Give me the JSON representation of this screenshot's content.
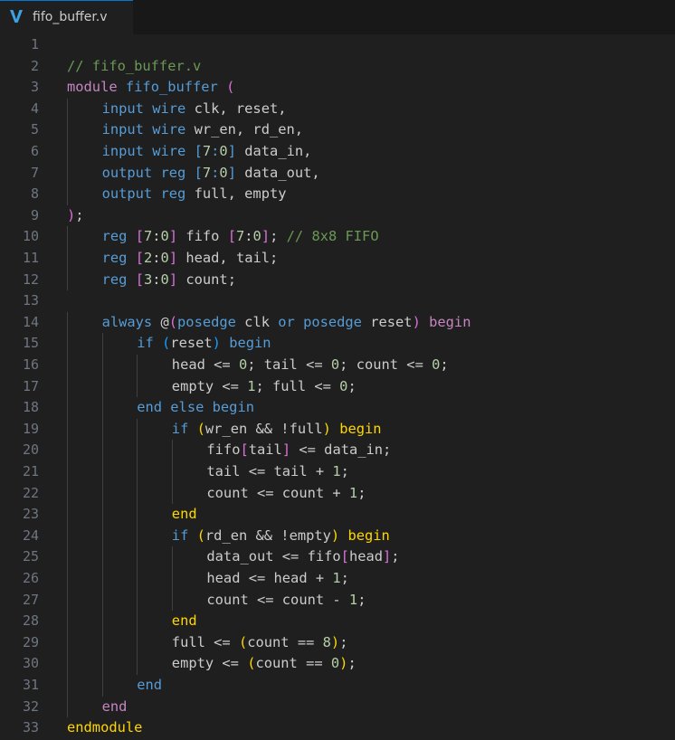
{
  "tab": {
    "icon": "verilog-file-icon",
    "label": "fifo_buffer.v",
    "accent": "#0078d4",
    "icon_color": "#3ca2e6"
  },
  "lines": [
    {
      "n": "1",
      "indent": 0,
      "tokens": []
    },
    {
      "n": "2",
      "indent": 0,
      "tokens": [
        {
          "t": "// fifo_buffer.v",
          "c": "cmt"
        }
      ]
    },
    {
      "n": "3",
      "indent": 0,
      "tokens": [
        {
          "t": "module",
          "c": "ctl"
        },
        {
          "t": " "
        },
        {
          "t": "fifo_buffer",
          "c": "kw"
        },
        {
          "t": " "
        },
        {
          "t": "(",
          "c": "paren-p"
        }
      ]
    },
    {
      "n": "4",
      "indent": 1,
      "tokens": [
        {
          "t": "input",
          "c": "kw"
        },
        {
          "t": " "
        },
        {
          "t": "wire",
          "c": "kw"
        },
        {
          "t": " clk, reset,"
        }
      ]
    },
    {
      "n": "5",
      "indent": 1,
      "tokens": [
        {
          "t": "input",
          "c": "kw"
        },
        {
          "t": " "
        },
        {
          "t": "wire",
          "c": "kw"
        },
        {
          "t": " wr_en, rd_en,"
        }
      ]
    },
    {
      "n": "6",
      "indent": 1,
      "tokens": [
        {
          "t": "input",
          "c": "kw"
        },
        {
          "t": " "
        },
        {
          "t": "wire",
          "c": "kw"
        },
        {
          "t": " "
        },
        {
          "t": "[",
          "c": "kw"
        },
        {
          "t": "7",
          "c": "num"
        },
        {
          "t": ":",
          "c": "kw"
        },
        {
          "t": "0",
          "c": "num"
        },
        {
          "t": "]",
          "c": "kw"
        },
        {
          "t": " data_in,"
        }
      ]
    },
    {
      "n": "7",
      "indent": 1,
      "tokens": [
        {
          "t": "output",
          "c": "kw"
        },
        {
          "t": " "
        },
        {
          "t": "reg",
          "c": "kw"
        },
        {
          "t": " "
        },
        {
          "t": "[",
          "c": "kw"
        },
        {
          "t": "7",
          "c": "num"
        },
        {
          "t": ":",
          "c": "kw"
        },
        {
          "t": "0",
          "c": "num"
        },
        {
          "t": "]",
          "c": "kw"
        },
        {
          "t": " data_out,"
        }
      ]
    },
    {
      "n": "8",
      "indent": 1,
      "tokens": [
        {
          "t": "output",
          "c": "kw"
        },
        {
          "t": " "
        },
        {
          "t": "reg",
          "c": "kw"
        },
        {
          "t": " full, empty"
        }
      ]
    },
    {
      "n": "9",
      "indent": 0,
      "tokens": [
        {
          "t": ")",
          "c": "paren-p"
        },
        {
          "t": ";"
        }
      ]
    },
    {
      "n": "10",
      "indent": 1,
      "tokens": [
        {
          "t": "reg",
          "c": "kw"
        },
        {
          "t": " "
        },
        {
          "t": "[",
          "c": "paren-p"
        },
        {
          "t": "7",
          "c": "num"
        },
        {
          "t": ":",
          "c": "id"
        },
        {
          "t": "0",
          "c": "num"
        },
        {
          "t": "]",
          "c": "paren-p"
        },
        {
          "t": " fifo "
        },
        {
          "t": "[",
          "c": "paren-p"
        },
        {
          "t": "7",
          "c": "num"
        },
        {
          "t": ":",
          "c": "id"
        },
        {
          "t": "0",
          "c": "num"
        },
        {
          "t": "]",
          "c": "paren-p"
        },
        {
          "t": "; "
        },
        {
          "t": "// 8x8 FIFO",
          "c": "cmt"
        }
      ]
    },
    {
      "n": "11",
      "indent": 1,
      "tokens": [
        {
          "t": "reg",
          "c": "kw"
        },
        {
          "t": " "
        },
        {
          "t": "[",
          "c": "paren-p"
        },
        {
          "t": "2",
          "c": "num"
        },
        {
          "t": ":",
          "c": "id"
        },
        {
          "t": "0",
          "c": "num"
        },
        {
          "t": "]",
          "c": "paren-p"
        },
        {
          "t": " head, tail;"
        }
      ]
    },
    {
      "n": "12",
      "indent": 1,
      "tokens": [
        {
          "t": "reg",
          "c": "kw"
        },
        {
          "t": " "
        },
        {
          "t": "[",
          "c": "paren-p"
        },
        {
          "t": "3",
          "c": "num"
        },
        {
          "t": ":",
          "c": "id"
        },
        {
          "t": "0",
          "c": "num"
        },
        {
          "t": "]",
          "c": "paren-p"
        },
        {
          "t": " count;"
        }
      ]
    },
    {
      "n": "13",
      "indent": 0,
      "tokens": []
    },
    {
      "n": "14",
      "indent": 1,
      "tokens": [
        {
          "t": "always",
          "c": "kw"
        },
        {
          "t": " @"
        },
        {
          "t": "(",
          "c": "paren-p"
        },
        {
          "t": "posedge",
          "c": "kw"
        },
        {
          "t": " clk "
        },
        {
          "t": "or",
          "c": "kw"
        },
        {
          "t": " "
        },
        {
          "t": "posedge",
          "c": "kw"
        },
        {
          "t": " reset"
        },
        {
          "t": ")",
          "c": "paren-p"
        },
        {
          "t": " "
        },
        {
          "t": "begin",
          "c": "ctl"
        }
      ]
    },
    {
      "n": "15",
      "indent": 2,
      "tokens": [
        {
          "t": "if",
          "c": "kw"
        },
        {
          "t": " "
        },
        {
          "t": "(",
          "c": "paren-b"
        },
        {
          "t": "reset"
        },
        {
          "t": ")",
          "c": "paren-b"
        },
        {
          "t": " "
        },
        {
          "t": "begin",
          "c": "kw"
        }
      ]
    },
    {
      "n": "16",
      "indent": 3,
      "tokens": [
        {
          "t": "head <= "
        },
        {
          "t": "0",
          "c": "num"
        },
        {
          "t": "; tail <= "
        },
        {
          "t": "0",
          "c": "num"
        },
        {
          "t": "; count <= "
        },
        {
          "t": "0",
          "c": "num"
        },
        {
          "t": ";"
        }
      ]
    },
    {
      "n": "17",
      "indent": 3,
      "tokens": [
        {
          "t": "empty <= "
        },
        {
          "t": "1",
          "c": "num"
        },
        {
          "t": "; full <= "
        },
        {
          "t": "0",
          "c": "num"
        },
        {
          "t": ";"
        }
      ]
    },
    {
      "n": "18",
      "indent": 2,
      "tokens": [
        {
          "t": "end",
          "c": "kw"
        },
        {
          "t": " "
        },
        {
          "t": "else",
          "c": "kw"
        },
        {
          "t": " "
        },
        {
          "t": "begin",
          "c": "kw"
        }
      ]
    },
    {
      "n": "19",
      "indent": 3,
      "tokens": [
        {
          "t": "if",
          "c": "kw"
        },
        {
          "t": " "
        },
        {
          "t": "(",
          "c": "bg"
        },
        {
          "t": "wr_en && !full"
        },
        {
          "t": ")",
          "c": "bg"
        },
        {
          "t": " "
        },
        {
          "t": "begin",
          "c": "bg"
        }
      ]
    },
    {
      "n": "20",
      "indent": 4,
      "tokens": [
        {
          "t": "fifo"
        },
        {
          "t": "[",
          "c": "paren-p"
        },
        {
          "t": "tail"
        },
        {
          "t": "]",
          "c": "paren-p"
        },
        {
          "t": " <= data_in;"
        }
      ]
    },
    {
      "n": "21",
      "indent": 4,
      "tokens": [
        {
          "t": "tail <= tail + "
        },
        {
          "t": "1",
          "c": "num"
        },
        {
          "t": ";"
        }
      ]
    },
    {
      "n": "22",
      "indent": 4,
      "tokens": [
        {
          "t": "count <= count + "
        },
        {
          "t": "1",
          "c": "num"
        },
        {
          "t": ";"
        }
      ]
    },
    {
      "n": "23",
      "indent": 3,
      "tokens": [
        {
          "t": "end",
          "c": "bg"
        }
      ]
    },
    {
      "n": "24",
      "indent": 3,
      "tokens": [
        {
          "t": "if",
          "c": "kw"
        },
        {
          "t": " "
        },
        {
          "t": "(",
          "c": "bg"
        },
        {
          "t": "rd_en && !empty"
        },
        {
          "t": ")",
          "c": "bg"
        },
        {
          "t": " "
        },
        {
          "t": "begin",
          "c": "bg"
        }
      ]
    },
    {
      "n": "25",
      "indent": 4,
      "tokens": [
        {
          "t": "data_out <= fifo"
        },
        {
          "t": "[",
          "c": "paren-p"
        },
        {
          "t": "head"
        },
        {
          "t": "]",
          "c": "paren-p"
        },
        {
          "t": ";"
        }
      ]
    },
    {
      "n": "26",
      "indent": 4,
      "tokens": [
        {
          "t": "head <= head + "
        },
        {
          "t": "1",
          "c": "num"
        },
        {
          "t": ";"
        }
      ]
    },
    {
      "n": "27",
      "indent": 4,
      "tokens": [
        {
          "t": "count <= count - "
        },
        {
          "t": "1",
          "c": "num"
        },
        {
          "t": ";"
        }
      ]
    },
    {
      "n": "28",
      "indent": 3,
      "tokens": [
        {
          "t": "end",
          "c": "bg"
        }
      ]
    },
    {
      "n": "29",
      "indent": 3,
      "tokens": [
        {
          "t": "full <= "
        },
        {
          "t": "(",
          "c": "bg"
        },
        {
          "t": "count == "
        },
        {
          "t": "8",
          "c": "num"
        },
        {
          "t": ")",
          "c": "bg"
        },
        {
          "t": ";"
        }
      ]
    },
    {
      "n": "30",
      "indent": 3,
      "tokens": [
        {
          "t": "empty <= "
        },
        {
          "t": "(",
          "c": "bg"
        },
        {
          "t": "count == "
        },
        {
          "t": "0",
          "c": "num"
        },
        {
          "t": ")",
          "c": "bg"
        },
        {
          "t": ";"
        }
      ]
    },
    {
      "n": "31",
      "indent": 2,
      "tokens": [
        {
          "t": "end",
          "c": "kw"
        }
      ]
    },
    {
      "n": "32",
      "indent": 1,
      "tokens": [
        {
          "t": "end",
          "c": "ctl"
        }
      ]
    },
    {
      "n": "33",
      "indent": 0,
      "tokens": [
        {
          "t": "endmodule",
          "c": "bg"
        }
      ]
    }
  ]
}
